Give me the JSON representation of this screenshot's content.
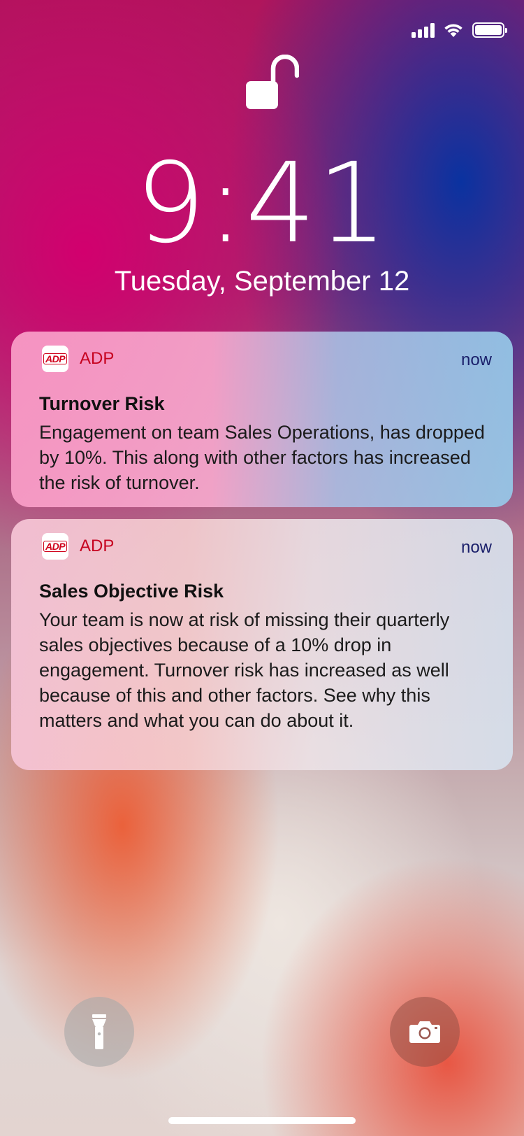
{
  "status_bar": {
    "signal_icon": "cellular-signal-icon",
    "wifi_icon": "wifi-icon",
    "battery_icon": "battery-icon",
    "battery_level": 1.0
  },
  "lock_screen": {
    "lock_icon": "unlocked-padlock-icon",
    "time": "9:41",
    "date": "Tuesday, September 12"
  },
  "notifications": [
    {
      "app_icon": "adp-logo-icon",
      "app_name": "ADP",
      "timestamp": "now",
      "title": "Turnover Risk",
      "body": "Engagement on team Sales Operations, has dropped by 10%. This along with other factors has increased the risk of turnover."
    },
    {
      "app_icon": "adp-logo-icon",
      "app_name": "ADP",
      "timestamp": "now",
      "title": "Sales Objective Risk",
      "body": "Your team is now at risk of missing their quarterly sales objectives because of a 10% drop in engagement. Turnover risk has increased as well because of this and other factors. See why this matters and what you can do about it."
    }
  ],
  "quick_actions": {
    "flashlight_icon": "flashlight-icon",
    "camera_icon": "camera-icon"
  },
  "colors": {
    "adp_red": "#d0021b",
    "timestamp_color": "#1a1f6a"
  }
}
